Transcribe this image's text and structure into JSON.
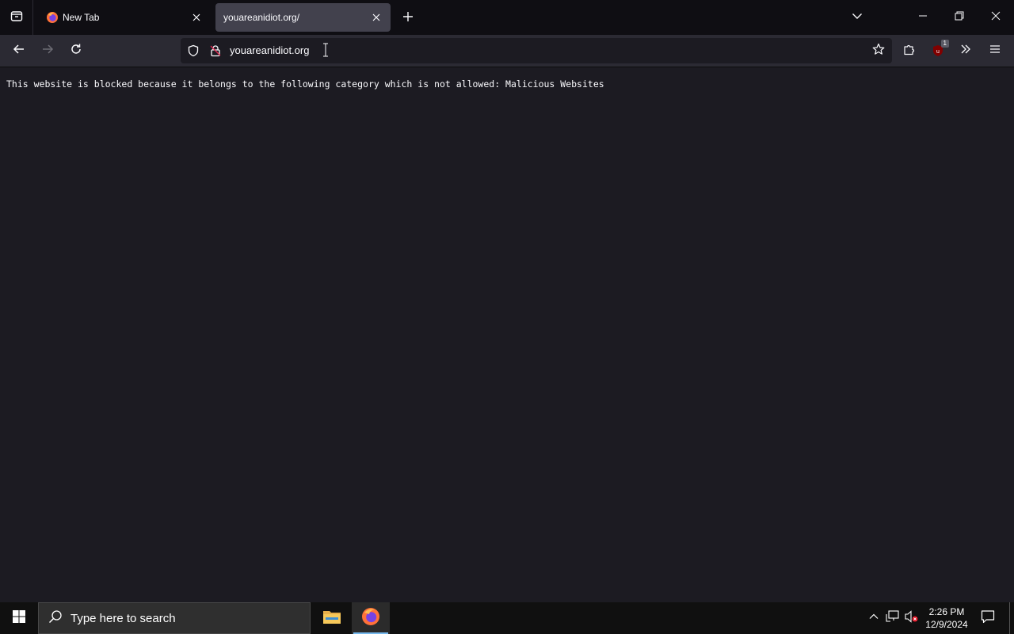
{
  "browser": {
    "tabs": [
      {
        "title": "New Tab",
        "active": false
      },
      {
        "title": "youareanidiot.org/",
        "active": true
      }
    ],
    "url": "youareanidiot.org",
    "extension_badge": "1"
  },
  "page": {
    "message": "This website is blocked because it belongs to the following category which is not allowed: Malicious Websites"
  },
  "taskbar": {
    "search_placeholder": "Type here to search",
    "time": "2:26 PM",
    "date": "12/9/2024"
  },
  "colors": {
    "tabbar_bg": "#0f0e13",
    "toolbar_bg": "#2b2a33",
    "content_bg": "#1c1b22",
    "active_tab_bg": "#42414d",
    "taskbar_bg": "#101010",
    "ublock_red": "#800000"
  }
}
